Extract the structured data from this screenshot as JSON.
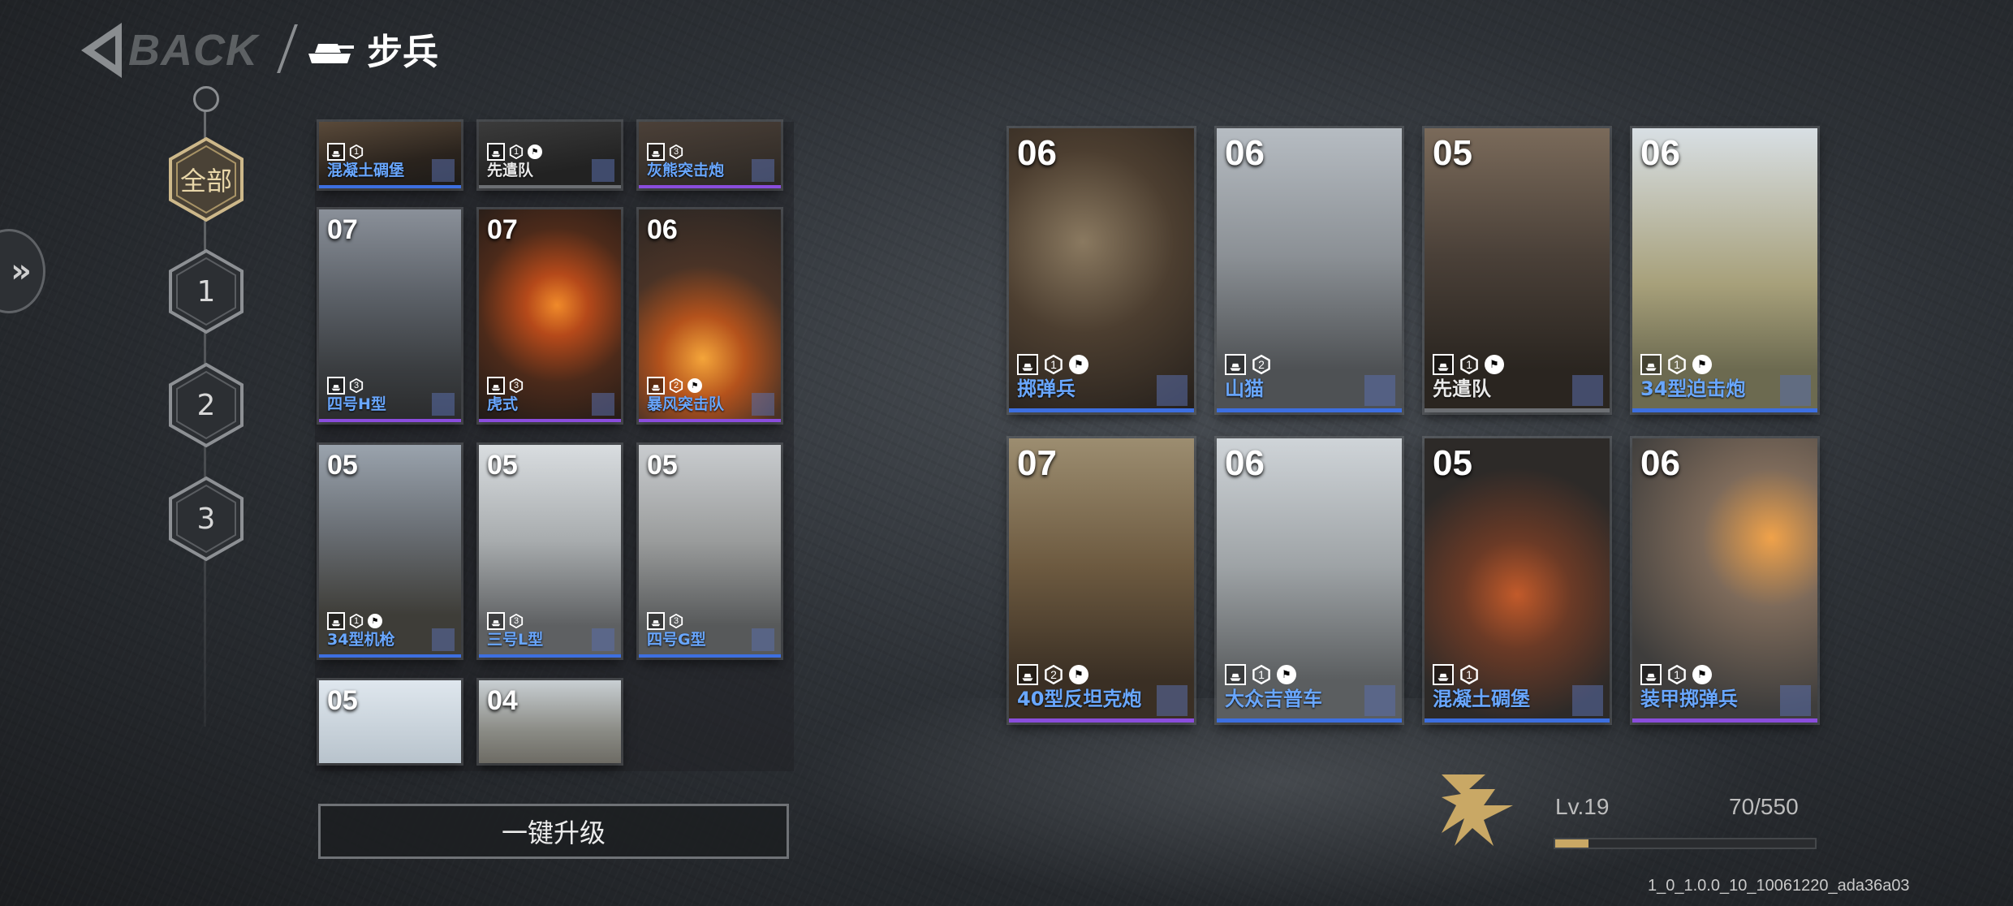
{
  "header": {
    "back_label": "BACK",
    "title": "步兵"
  },
  "tiers": [
    {
      "label": "全部",
      "active": true
    },
    {
      "label": "1",
      "active": false
    },
    {
      "label": "2",
      "active": false
    },
    {
      "label": "3",
      "active": false
    }
  ],
  "collection": [
    {
      "cost": "",
      "type_icon": "bunker-icon",
      "count": "1",
      "flag": false,
      "name": "混凝土碉堡",
      "rarity": "blue"
    },
    {
      "cost": "",
      "type_icon": "wrench-icon",
      "count": "1",
      "flag": true,
      "name": "先遣队",
      "rarity": "gray"
    },
    {
      "cost": "",
      "type_icon": "tank-icon",
      "count": "3",
      "flag": false,
      "name": "灰熊突击炮",
      "rarity": "purple"
    },
    {
      "cost": "07",
      "type_icon": "tank-icon",
      "count": "3",
      "flag": false,
      "name": "四号H型",
      "rarity": "purple"
    },
    {
      "cost": "07",
      "type_icon": "tank-icon",
      "count": "3",
      "flag": false,
      "name": "虎式",
      "rarity": "purple"
    },
    {
      "cost": "06",
      "type_icon": "crossed-icon",
      "count": "2",
      "flag": true,
      "name": "暴风突击队",
      "rarity": "purple"
    },
    {
      "cost": "05",
      "type_icon": "bunker-icon",
      "count": "1",
      "flag": true,
      "name": "34型机枪",
      "rarity": "blue"
    },
    {
      "cost": "05",
      "type_icon": "tank-icon",
      "count": "3",
      "flag": false,
      "name": "三号L型",
      "rarity": "blue"
    },
    {
      "cost": "05",
      "type_icon": "tank-icon",
      "count": "3",
      "flag": false,
      "name": "四号G型",
      "rarity": "blue"
    },
    {
      "cost": "05",
      "type_icon": "",
      "count": "",
      "flag": false,
      "name": "",
      "rarity": ""
    },
    {
      "cost": "04",
      "type_icon": "",
      "count": "",
      "flag": false,
      "name": "",
      "rarity": ""
    }
  ],
  "deck": [
    {
      "cost": "06",
      "type_icon": "v-icon",
      "count": "1",
      "flag": true,
      "name": "掷弹兵",
      "rarity": "blue"
    },
    {
      "cost": "06",
      "type_icon": "tank-icon",
      "count": "2",
      "flag": false,
      "name": "山猫",
      "rarity": "blue"
    },
    {
      "cost": "05",
      "type_icon": "wrench-icon",
      "count": "1",
      "flag": true,
      "name": "先遣队",
      "rarity": "gray"
    },
    {
      "cost": "06",
      "type_icon": "mortar-icon",
      "count": "1",
      "flag": true,
      "name": "34型迫击炮",
      "rarity": "blue"
    },
    {
      "cost": "07",
      "type_icon": "gun-icon",
      "count": "2",
      "flag": true,
      "name": "40型反坦克炮",
      "rarity": "purple"
    },
    {
      "cost": "06",
      "type_icon": "car-icon",
      "count": "1",
      "flag": true,
      "name": "大众吉普车",
      "rarity": "blue"
    },
    {
      "cost": "05",
      "type_icon": "bunker-icon",
      "count": "1",
      "flag": false,
      "name": "混凝土碉堡",
      "rarity": "blue"
    },
    {
      "cost": "06",
      "type_icon": "armored-icon",
      "count": "1",
      "flag": true,
      "name": "装甲掷弹兵",
      "rarity": "purple"
    }
  ],
  "actions": {
    "upgrade_all_label": "一键升级"
  },
  "player": {
    "level_label": "Lv.19",
    "xp_text": "70/550",
    "xp_fraction": 0.127
  },
  "build": {
    "version": "1_0_1.0.0_10_10061220_ada36a03"
  },
  "colors": {
    "accent_gold": "#c9a865",
    "rarity_blue": "#3d6fe0",
    "rarity_purple": "#8a4ddc",
    "name_blue": "#69a7ff"
  }
}
